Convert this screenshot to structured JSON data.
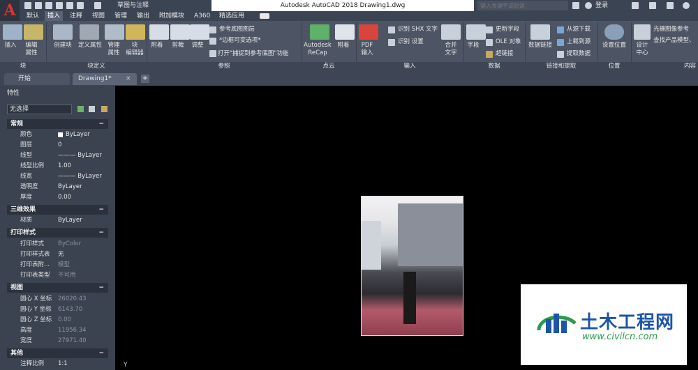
{
  "app": {
    "title": "Autodesk AutoCAD 2018    Drawing1.dwg",
    "logo_letter": "A",
    "workspace": "草图与注释",
    "search_placeholder": "键入关键字或短语",
    "login": "登录"
  },
  "menu_tabs": [
    "默认",
    "插入",
    "注释",
    "视图",
    "管理",
    "输出",
    "附加模块",
    "A360",
    "精选应用"
  ],
  "active_tab": "插入",
  "ribbon": {
    "block": {
      "insert": "插入",
      "edit_attr": "编辑\n属性",
      "title": "块"
    },
    "block_def": {
      "create": "创建块",
      "define_attr": "定义属性",
      "manage_attr": "管理\n属性",
      "block_editor": "块\n编辑器",
      "title": "块定义"
    },
    "reference": {
      "attach": "附着",
      "clip": "剪裁",
      "adjust": "调整",
      "underlay_layers": "参考底图图层",
      "frame": "*边框可变选项*",
      "snap": "打开\"捕捉到参考底图\"功能",
      "title": "参照"
    },
    "point_cloud": {
      "recap": "Autodesk\nReCap",
      "attach": "附着",
      "title": "点云"
    },
    "import": {
      "pdf": "PDF\n输入",
      "shx": "识别 SHX 文字",
      "settings": "识别 设置",
      "combine": "合并\n文字",
      "title": "输入"
    },
    "data": {
      "field": "字段",
      "update_field": "更新字段",
      "ole": "OLE 对象",
      "hyperlink": "超链接",
      "title": "数据"
    },
    "linking": {
      "data_link": "数据链接",
      "download": "从源下载",
      "upload": "上载到源",
      "extract": "提取数据",
      "title": "链接和提取"
    },
    "location": {
      "set_location": "设置位置",
      "title": "位置"
    },
    "content": {
      "design_center": "设计\n中心",
      "raster_ref": "光栅图像参考",
      "find_models": "查找产品模型、",
      "title": "内容"
    }
  },
  "doc_tabs": [
    "开始",
    "Drawing1*"
  ],
  "palette": {
    "title": "特性",
    "selection": "无选择",
    "sections": [
      {
        "name": "常规",
        "toggle": "−",
        "rows": [
          {
            "label": "颜色",
            "value": "ByLayer"
          },
          {
            "label": "图层",
            "value": "0"
          },
          {
            "label": "线型",
            "value": "——— ByLayer"
          },
          {
            "label": "线型比例",
            "value": "1.00"
          },
          {
            "label": "线宽",
            "value": "——— ByLayer"
          },
          {
            "label": "透明度",
            "value": "ByLayer"
          },
          {
            "label": "厚度",
            "value": "0.00"
          }
        ]
      },
      {
        "name": "三维效果",
        "toggle": "−",
        "rows": [
          {
            "label": "材质",
            "value": "ByLayer"
          }
        ]
      },
      {
        "name": "打印样式",
        "toggle": "−",
        "rows": [
          {
            "label": "打印样式",
            "value": "ByColor"
          },
          {
            "label": "打印样式表",
            "value": "无"
          },
          {
            "label": "打印表附...",
            "value": "模型"
          },
          {
            "label": "打印表类型",
            "value": "不可用"
          }
        ]
      },
      {
        "name": "视图",
        "toggle": "−",
        "rows": [
          {
            "label": "圆心 X 坐标",
            "value": "26020.43"
          },
          {
            "label": "圆心 Y 坐标",
            "value": "6143.70"
          },
          {
            "label": "圆心 Z 坐标",
            "value": "0.00"
          },
          {
            "label": "高度",
            "value": "11956.34"
          },
          {
            "label": "宽度",
            "value": "27971.40"
          }
        ]
      },
      {
        "name": "其他",
        "toggle": "−",
        "rows": [
          {
            "label": "注释比例",
            "value": "1:1"
          }
        ]
      }
    ]
  },
  "watermark": {
    "text": "土木工程网",
    "url": "www.civilcn.com"
  },
  "ucs_label": "Y",
  "colors": {
    "accent_red": "#e03030",
    "panel": "#3b4250",
    "ribbon": "#4d5565"
  }
}
